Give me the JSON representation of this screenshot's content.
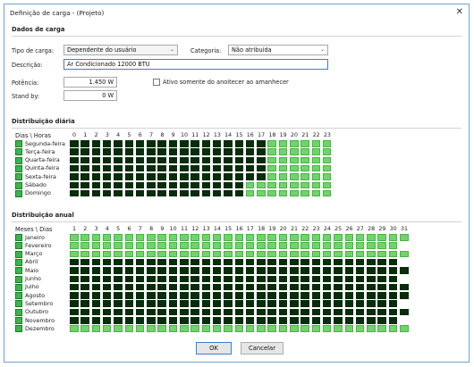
{
  "window": {
    "title": "Definição de carga - (Projeto)",
    "close": "✕"
  },
  "dados": {
    "section": "Dados de carga",
    "tipo_label": "Tipo de carga:",
    "tipo_value": "Dependente do usuário",
    "categoria_label": "Categoria:",
    "categoria_value": "Não atribuída",
    "descricao_label": "Descrição:",
    "descricao_value": "Ar Condicionado 12000 BTU",
    "potencia_label": "Potência:",
    "potencia_value": "1.450 W",
    "standby_label": "Stand by:",
    "standby_value": "0 W",
    "ativo_label": "Ativo somente do anoitecer ao amanhecer",
    "ativo_checked": false
  },
  "diaria": {
    "section": "Distribuição diária",
    "corner": "Dias \\ Horas",
    "hours": [
      "0",
      "1",
      "2",
      "3",
      "4",
      "5",
      "6",
      "7",
      "8",
      "9",
      "10",
      "11",
      "12",
      "13",
      "14",
      "15",
      "16",
      "17",
      "18",
      "19",
      "20",
      "21",
      "22",
      "23"
    ],
    "days": [
      "Segunda-feira",
      "Terça-feira",
      "Quarta-feira",
      "Quinta-feira",
      "Sexta-feira",
      "Sábado",
      "Domingo"
    ],
    "grid": [
      "111111111111111111000000",
      "111111111111111111000000",
      "111111111111111111000000",
      "111111111111111111000000",
      "111111111111111111000000",
      "111111111111111100000000",
      "111111111111111100000000"
    ]
  },
  "anual": {
    "section": "Distribuição anual",
    "corner": "Meses \\ Dias",
    "days": [
      "1",
      "2",
      "3",
      "4",
      "5",
      "6",
      "7",
      "8",
      "9",
      "10",
      "11",
      "12",
      "13",
      "14",
      "15",
      "16",
      "17",
      "18",
      "19",
      "20",
      "21",
      "22",
      "23",
      "24",
      "25",
      "26",
      "27",
      "28",
      "29",
      "30",
      "31"
    ],
    "months": [
      "Janeiro",
      "Fevereiro",
      "Março",
      "Abril",
      "Maio",
      "Junho",
      "Julho",
      "Agosto",
      "Setembro",
      "Outubro",
      "Novembro",
      "Dezembro"
    ],
    "grid": [
      "0000000000000000000000000000000",
      "000000000000000000000000000000x",
      "0000000000000000000000000000000",
      "111111111111111111111111111111x",
      "1111111111111111111111111111111",
      "111111111111111111111111111111x",
      "1111111111111111111111111111111",
      "1111111111111111111111111111111",
      "111111111111111111111111111111x",
      "1111111111111111111111111111111",
      "111111111111111111111111111111x",
      "0000000000000000000000000000000"
    ]
  },
  "buttons": {
    "ok": "OK",
    "cancel": "Cancelar"
  }
}
